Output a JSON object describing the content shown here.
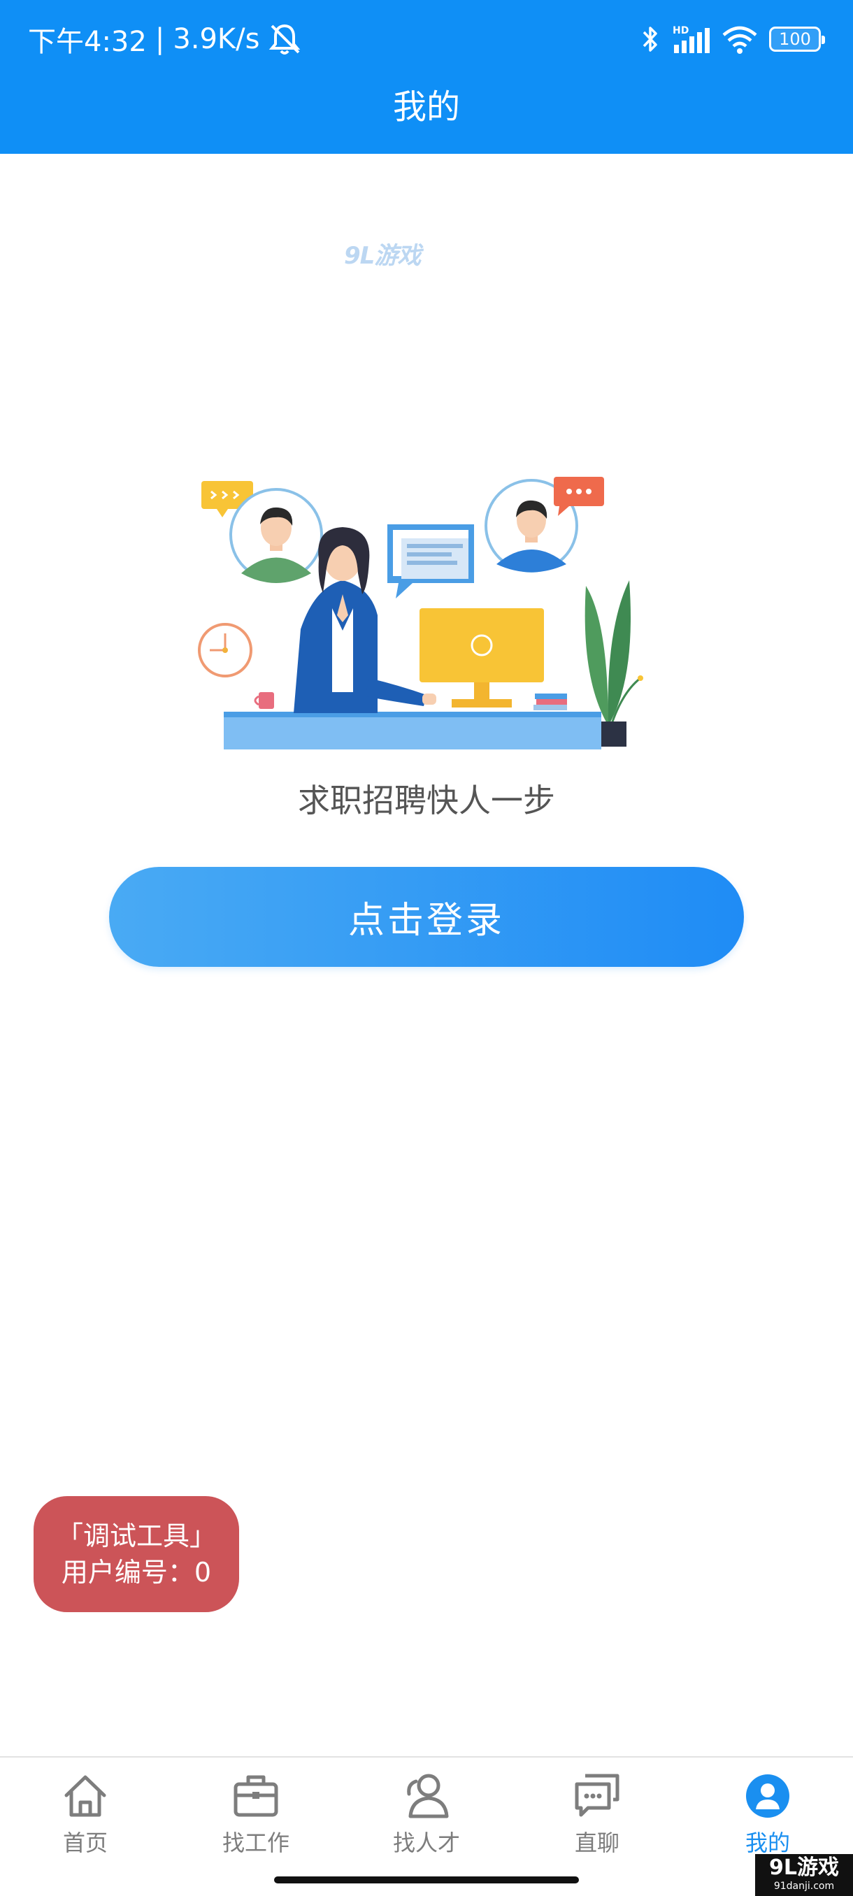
{
  "status_bar": {
    "time": "下午4:32",
    "separator": "|",
    "net_speed": "3.9K/s",
    "network_label": "HD",
    "battery": "100"
  },
  "header": {
    "title": "我的"
  },
  "watermark": {
    "top": "9L游戏",
    "bottom": "9L游戏",
    "bottom_url": "91danji.com"
  },
  "main": {
    "slogan": "求职招聘快人一步",
    "login_button": "点击登录"
  },
  "debug_tool": {
    "title": "「调试工具」",
    "user_id": "用户编号：0"
  },
  "tabbar": {
    "active_color": "#1a8ff0",
    "inactive_color": "#7d7d7d",
    "items": [
      {
        "label": "首页",
        "icon": "home-icon"
      },
      {
        "label": "找工作",
        "icon": "briefcase-icon"
      },
      {
        "label": "找人才",
        "icon": "people-icon"
      },
      {
        "label": "直聊",
        "icon": "chat-icon"
      },
      {
        "label": "我的",
        "icon": "profile-icon",
        "active": true
      }
    ]
  },
  "colors": {
    "header_blue": "#0f8ff6",
    "button_gradient_start": "#49aaf4",
    "button_gradient_end": "#1f8cf5",
    "debug_badge": "#cc5458"
  }
}
